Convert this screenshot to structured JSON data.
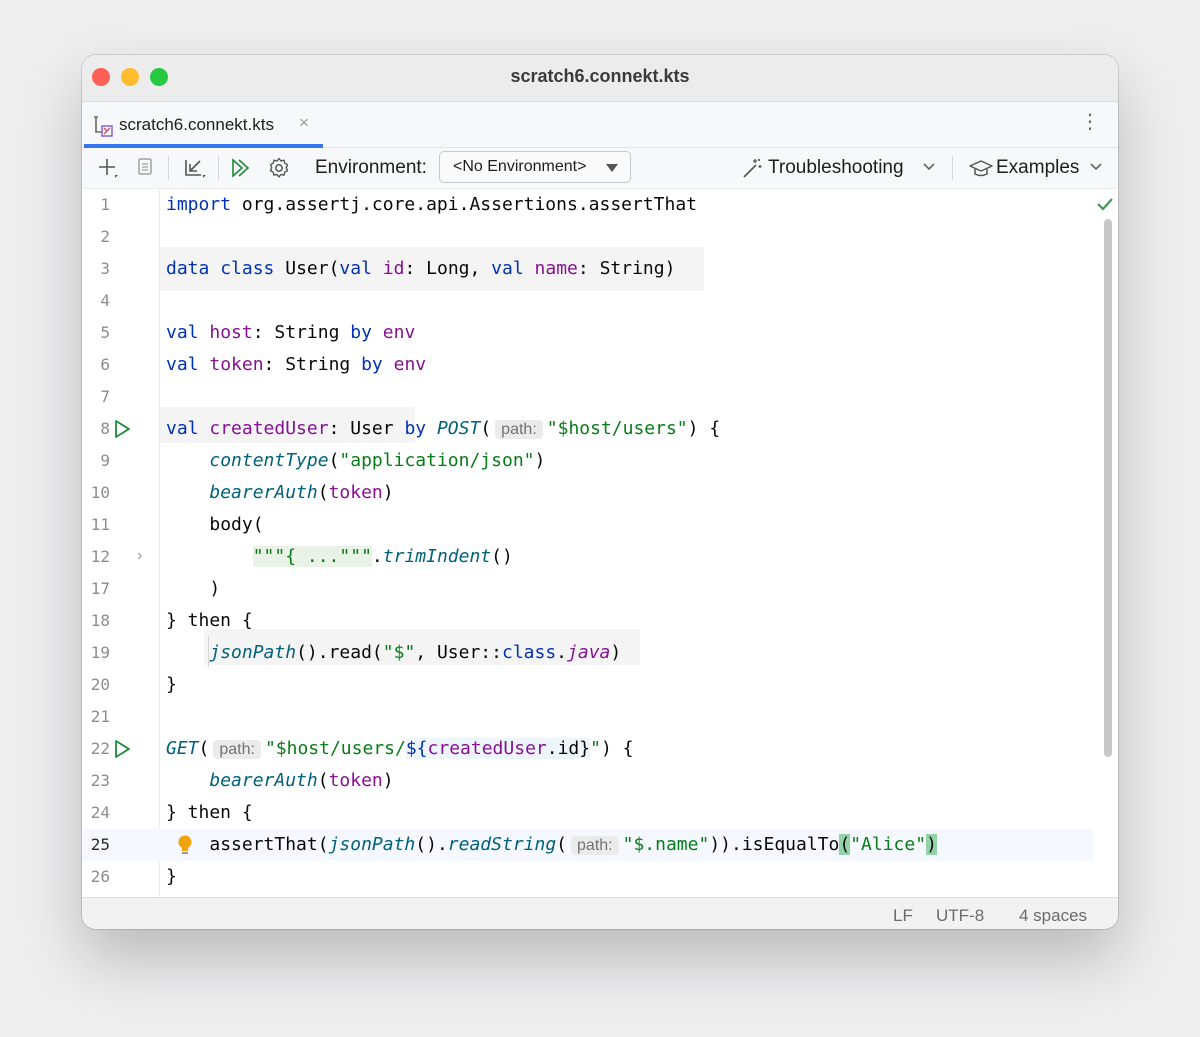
{
  "window": {
    "title": "scratch6.connekt.kts"
  },
  "tab": {
    "label": "scratch6.connekt.kts",
    "close": "×"
  },
  "toolbar": {
    "environment_label": "Environment:",
    "environment_value": "<No Environment>",
    "troubleshooting": "Troubleshooting",
    "examples": "Examples"
  },
  "editor": {
    "line_numbers": [
      "1",
      "2",
      "3",
      "4",
      "5",
      "6",
      "7",
      "8",
      "9",
      "10",
      "11",
      "12",
      "17",
      "18",
      "19",
      "20",
      "21",
      "22",
      "23",
      "24",
      "25",
      "26"
    ],
    "current_line": "25",
    "inlay_hint_path": "path:",
    "lines": {
      "l1": {
        "import": "import",
        "rest": " org.assertj.core.api.Assertions.assertThat"
      },
      "l3": {
        "data": "data",
        "class": "class",
        "user": " User(",
        "val1": "val",
        "id": "id",
        "long": ": Long, ",
        "val2": "val",
        "name": "name",
        "string": ": String)"
      },
      "l5": {
        "val": "val",
        "host": "host",
        "mid": ": String ",
        "by": "by",
        "env": "env"
      },
      "l6": {
        "val": "val",
        "token": "token",
        "mid": ": String ",
        "by": "by",
        "env": "env"
      },
      "l8": {
        "val": "val",
        "created": "createdUser",
        "type": ": User ",
        "by": "by",
        "post": "POST",
        "paren": "(",
        "str": "\"$host/users\"",
        "end": ") {"
      },
      "l9": {
        "fn": "contentType",
        "open": "(",
        "str": "\"application/json\"",
        "close": ")"
      },
      "l10": {
        "fn": "bearerAuth",
        "open": "(",
        "arg": "token",
        "close": ")"
      },
      "l11": {
        "text": "body("
      },
      "l12": {
        "fold": "\"\"\"{ ...\"\"\"",
        "dot": ".",
        "fn": "trimIndent",
        "end": "()"
      },
      "l17": {
        "text": ")"
      },
      "l18": {
        "text": "} then {"
      },
      "l19": {
        "fn": "jsonPath",
        "mid": "().read(",
        "str": "\"$\"",
        "cls": ", User::",
        "kw": "class",
        "dot": ".",
        "java": "java",
        "end": ")"
      },
      "l20": {
        "text": "}"
      },
      "l22": {
        "get": "GET",
        "paren": "(",
        "s1": "\"$host/users/",
        "tpl1": "${",
        "created": "createdUser",
        "tpl2": ".id}",
        "s2": "\"",
        "end": ") {"
      },
      "l23": {
        "fn": "bearerAuth",
        "open": "(",
        "arg": "token",
        "close": ")"
      },
      "l24": {
        "text": "} then {"
      },
      "l25": {
        "a1": "assertThat(",
        "fn1": "jsonPath",
        "dot": "().",
        "fn2": "readString",
        "paren": "(",
        "str": "\"$.name\"",
        "mid": ")).isEqualTo",
        "po": "(",
        "alice": "\"Alice\"",
        "pc": ")"
      },
      "l26": {
        "text": "}"
      }
    }
  },
  "status": {
    "line_sep": "LF",
    "encoding": "UTF-8",
    "indent": "4 spaces"
  },
  "colors": {
    "keyword": "#0033b3",
    "property": "#871094",
    "function": "#00627a",
    "string": "#067d17",
    "accent": "#3574f0"
  }
}
